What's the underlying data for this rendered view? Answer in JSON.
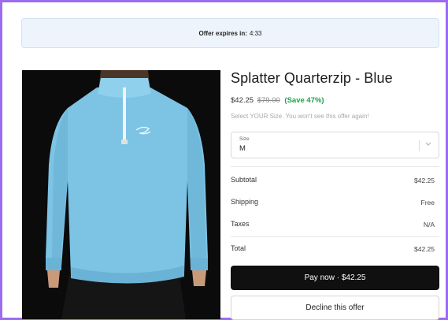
{
  "offer_banner": {
    "label": "Offer expires in:",
    "countdown": "4:33"
  },
  "product": {
    "title": "Splatter Quarterzip - Blue",
    "price": "$42.25",
    "original_price": "$79.00",
    "savings": "(Save 47%)",
    "hint": "Select YOUR Size. You won't see this offer again!",
    "image_alt": "Man wearing a light blue splatter quarter-zip pullover",
    "shirt_color": "#7cc3e4"
  },
  "size_select": {
    "label": "Size",
    "value": "M",
    "icon": "chevron-down-icon"
  },
  "summary": {
    "subtotal_label": "Subtotal",
    "subtotal_value": "$42.25",
    "shipping_label": "Shipping",
    "shipping_value": "Free",
    "taxes_label": "Taxes",
    "taxes_value": "N/A",
    "total_label": "Total",
    "total_value": "$42.25"
  },
  "actions": {
    "pay_label": "Pay now · $42.25",
    "decline_label": "Decline this offer"
  },
  "colors": {
    "frame_border": "#9b6cf2",
    "banner_bg": "#eef4fc",
    "save_green": "#1aa34a",
    "pay_button_bg": "#101010"
  }
}
